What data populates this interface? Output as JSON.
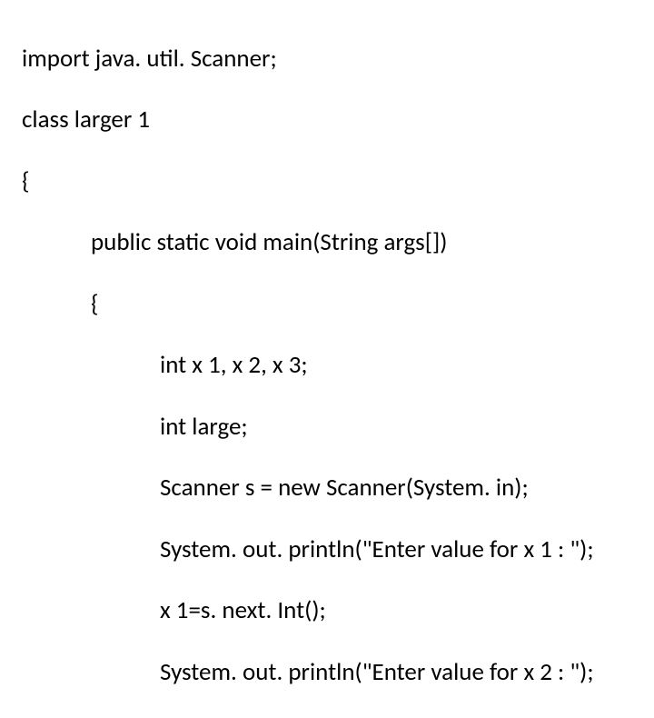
{
  "code": {
    "l1": "import java. util. Scanner;",
    "l2": "class larger 1",
    "l3": "{",
    "l4": "public static void main(String args[])",
    "l5": "{",
    "l6": "int x 1, x 2, x 3;",
    "l7": "int large;",
    "l8": "Scanner s = new Scanner(System. in);",
    "l9": "System. out. println(\"Enter value for x 1 : \");",
    "l10": "x 1=s. next. Int();",
    "l11": "System. out. println(\"Enter value for x 2 : \");"
  }
}
